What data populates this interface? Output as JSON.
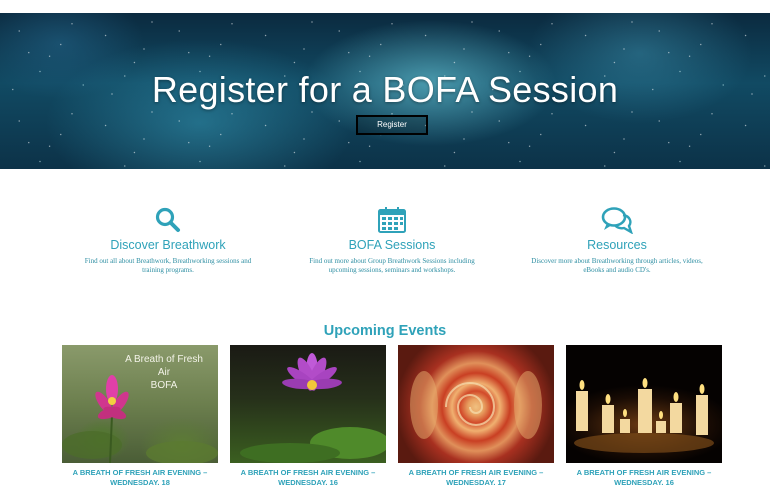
{
  "hero": {
    "title": "Register for a BOFA Session",
    "button_label": "Register",
    "slide_count": 6,
    "active_slide": 1
  },
  "features": [
    {
      "icon": "search-icon",
      "title": "Discover Breathwork",
      "description": "Find out all about Breathwork, Breathworking sessions and training programs."
    },
    {
      "icon": "calendar-icon",
      "title": "BOFA Sessions",
      "description": "Find out more about Group Breathwork Sessions including upcoming sessions, seminars and workshops."
    },
    {
      "icon": "chat-bubbles-icon",
      "title": "Resources",
      "description": "Discover more about Breathworking through articles, videos, eBooks and audio CD's."
    }
  ],
  "events": {
    "heading": "Upcoming Events",
    "items": [
      {
        "image_label": "A Breath of Fresh Air\nBOFA",
        "title": "A BREATH OF FRESH AIR EVENING – WEDNESDAY, 18"
      },
      {
        "image_label": "",
        "title": "A BREATH OF FRESH AIR EVENING – WEDNESDAY, 16"
      },
      {
        "image_label": "",
        "title": "A BREATH OF FRESH AIR EVENING – WEDNESDAY, 17"
      },
      {
        "image_label": "",
        "title": "A BREATH OF FRESH AIR EVENING – WEDNESDAY, 16"
      }
    ]
  },
  "colors": {
    "accent": "#2fa2b9",
    "hero_bg": "#114a63"
  }
}
